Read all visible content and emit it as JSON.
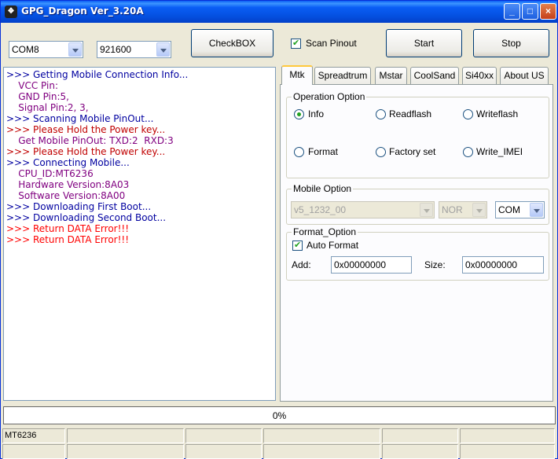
{
  "window": {
    "title": "GPG_Dragon  Ver_3.20A",
    "controls": [
      "_",
      "□",
      "×"
    ]
  },
  "toolbar": {
    "port": "COM8",
    "baud": "921600",
    "checkbox_button": "CheckBOX",
    "scan_pinout_label": "Scan Pinout",
    "scan_pinout_checked": true,
    "start_label": "Start",
    "stop_label": "Stop"
  },
  "log": [
    {
      "text": ">>> Getting Mobile Connection Info...",
      "color": "#0000a0"
    },
    {
      "text": "    VCC Pin:",
      "color": "#800080"
    },
    {
      "text": "    GND Pin:5,",
      "color": "#800080"
    },
    {
      "text": "    Signal Pin:2, 3,",
      "color": "#800080"
    },
    {
      "text": ">>> Scanning Mobile PinOut...",
      "color": "#0000a0"
    },
    {
      "text": ">>> Please Hold the Power key...",
      "color": "#c00000"
    },
    {
      "text": "    Get Mobile PinOut: TXD:2  RXD:3",
      "color": "#800080"
    },
    {
      "text": ">>> Please Hold the Power key...",
      "color": "#c00000"
    },
    {
      "text": ">>> Connecting Mobile...",
      "color": "#0000a0"
    },
    {
      "text": "    CPU_ID:MT6236",
      "color": "#800080"
    },
    {
      "text": "    Hardware Version:8A03",
      "color": "#800080"
    },
    {
      "text": "    Software Version:8A00",
      "color": "#800080"
    },
    {
      "text": ">>> Downloading First Boot...",
      "color": "#0000a0"
    },
    {
      "text": ">>> Downloading Second Boot...",
      "color": "#0000a0"
    },
    {
      "text": ">>> Return DATA Error!!!",
      "color": "#ff0000"
    },
    {
      "text": ">>> Return DATA Error!!!",
      "color": "#ff0000"
    }
  ],
  "tabs": [
    "Mtk",
    "Spreadtrum",
    "Mstar",
    "CoolSand",
    "Si40xx",
    "About US"
  ],
  "active_tab": "Mtk",
  "operation": {
    "title": "Operation Option",
    "options": [
      "Info",
      "Readflash",
      "Writeflash",
      "Format",
      "Factory set",
      "Write_IMEI"
    ],
    "selected": "Info"
  },
  "mobile": {
    "title": "Mobile Option",
    "model": "v5_1232_00",
    "flash": "NOR",
    "port": "COM"
  },
  "format": {
    "title": "Format_Option",
    "auto_format_label": "Auto Format",
    "auto_format_checked": true,
    "add_label": "Add:",
    "add_value": "0x00000000",
    "size_label": "Size:",
    "size_value": "0x00000000"
  },
  "progress": {
    "value": 0,
    "text": "0%"
  },
  "status": {
    "chip": "MT6236"
  },
  "colors": {
    "title_bar": "#0a5ef5",
    "dialog": "#ece9d8",
    "progress_fill": "#2a9a2a"
  }
}
